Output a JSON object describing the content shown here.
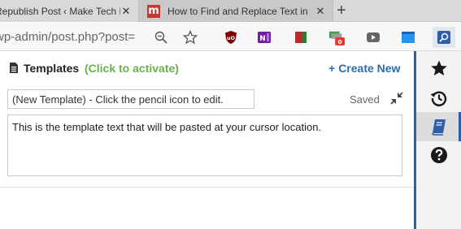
{
  "browser": {
    "tabs": [
      {
        "title": "Republish Post ‹ Make Tech Easier",
        "close": "✕"
      },
      {
        "title": "How to Find and Replace Text in",
        "close": "✕"
      }
    ],
    "new_tab": "+",
    "url": "wp-admin/post.php?post=",
    "icons": [
      "zoom-icon",
      "star-icon"
    ],
    "extensions": [
      {
        "name": "ublock-origin",
        "color": "#800000"
      },
      {
        "name": "onenote-clipper",
        "color": "#7719aa"
      },
      {
        "name": "red-book",
        "color": "#c62828"
      },
      {
        "name": "notifier",
        "badge": "0",
        "color": "#43a047"
      },
      {
        "name": "video",
        "color": "#666666"
      },
      {
        "name": "window",
        "color": "#2196f3"
      },
      {
        "name": "text-blaze-search",
        "color": "#2d5fa8"
      }
    ]
  },
  "panel": {
    "title": "Templates",
    "activate_hint": "(Click to activate)",
    "create_new": "Create New",
    "template_name": "(New Template) - Click the pencil icon to edit.",
    "status": "Saved",
    "template_text": "This is the template text that will be pasted at your cursor location."
  },
  "sidebar": {
    "buttons": [
      "star-icon",
      "history-icon",
      "book-icon",
      "help-icon"
    ],
    "active_index": 2
  }
}
